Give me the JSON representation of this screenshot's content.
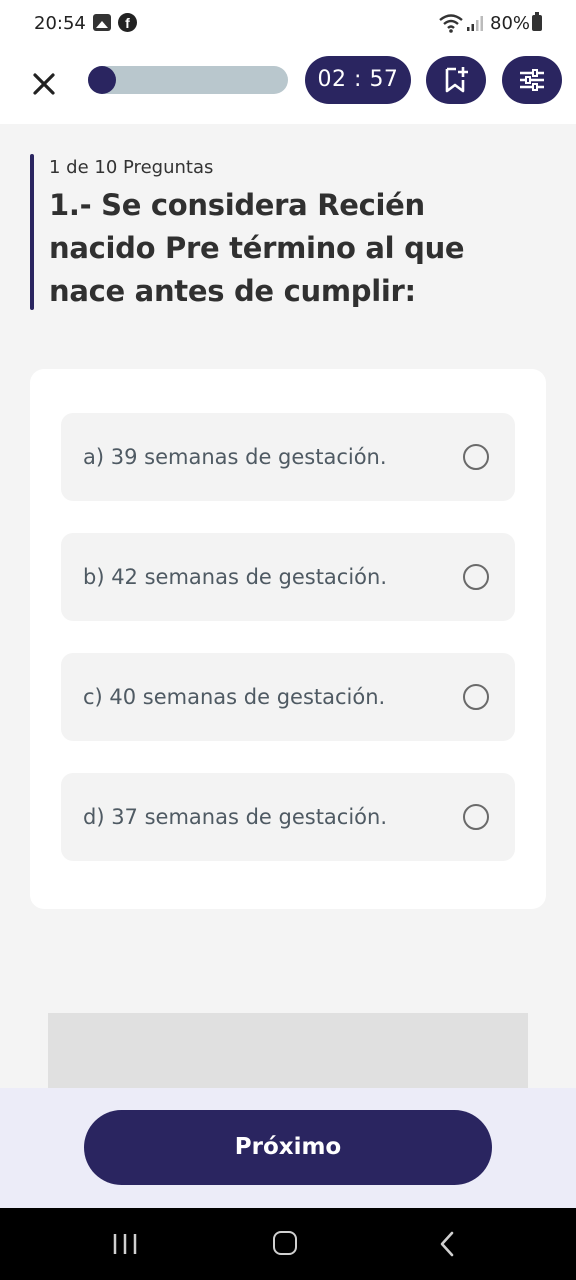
{
  "status_bar": {
    "time": "20:54",
    "battery": "80%"
  },
  "header": {
    "progress_fraction": 0.1,
    "timer": "02 : 57",
    "accent_color": "#2a2560"
  },
  "question": {
    "counter": "1 de 10 Preguntas",
    "text": "1.- Se considera Recién nacido Pre término al que nace antes de cumplir:"
  },
  "options": [
    {
      "label": "a) 39 semanas de gestación."
    },
    {
      "label": "b) 42 semanas de gestación."
    },
    {
      "label": "c) 40 semanas de gestación."
    },
    {
      "label": "d) 37 semanas de gestación."
    }
  ],
  "footer": {
    "next_label": "Próximo"
  }
}
